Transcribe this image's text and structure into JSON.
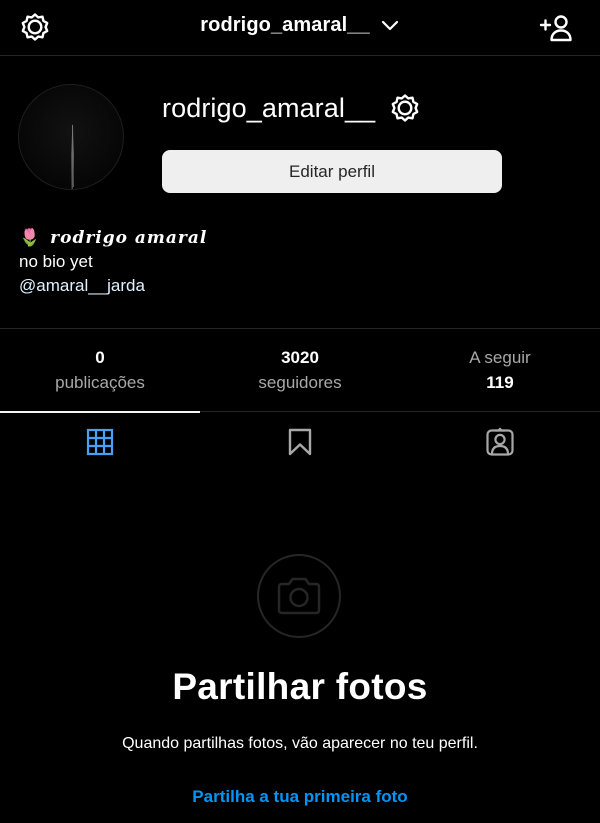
{
  "colors": {
    "background": "#000000",
    "text": "#ffffff",
    "muted": "#a8a8a8",
    "divider": "#262626",
    "accent_blue": "#4a9ff5",
    "link_blue": "#0095f6",
    "button_bg": "#efefef"
  },
  "topbar": {
    "username": "rodrigo_amaral__",
    "left_icon": "settings-gear-icon",
    "dropdown_icon": "chevron-down-icon",
    "right_icon": "add-user-icon"
  },
  "profile": {
    "username": "rodrigo_amaral__",
    "settings_icon": "settings-gear-icon",
    "edit_button_label": "Editar perfil",
    "bio": {
      "emoji": "🌷",
      "full_name": "𝒓𝒐𝒅𝒓𝒊𝒈𝒐 𝒂𝒎𝒂𝒓𝒂𝒍",
      "line1": "no bio yet",
      "mention": "@amaral__jarda"
    }
  },
  "stats": [
    {
      "value": "0",
      "label": "publicações",
      "value_first": true
    },
    {
      "value": "3020",
      "label": "seguidores",
      "value_first": true
    },
    {
      "value": "119",
      "label": "A seguir",
      "value_first": false
    }
  ],
  "tabs": [
    {
      "name": "posts-grid",
      "icon": "grid-icon",
      "active": true
    },
    {
      "name": "saved",
      "icon": "bookmark-icon",
      "active": false
    },
    {
      "name": "tagged",
      "icon": "tagged-person-icon",
      "active": false
    }
  ],
  "empty_state": {
    "icon": "camera-icon",
    "title": "Partilhar fotos",
    "subtitle": "Quando partilhas fotos, vão aparecer no teu perfil.",
    "link": "Partilha a tua primeira foto"
  }
}
